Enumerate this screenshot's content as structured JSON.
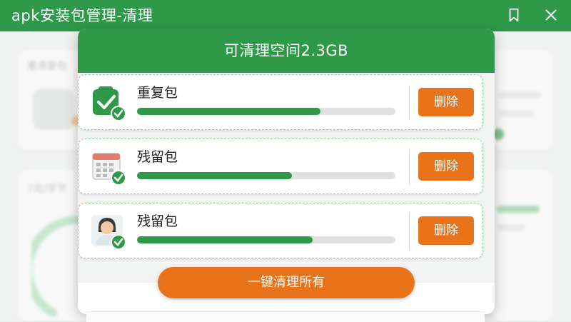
{
  "app": {
    "title": "apk安装包管理-清理",
    "icons": [
      "bookmark-icon",
      "close-icon"
    ]
  },
  "dialog": {
    "title": "可清理空间2.3GB",
    "items": [
      {
        "label": "重复包",
        "progress": 0.71,
        "icon": "duplicate-package-icon",
        "delete_label": "删除"
      },
      {
        "label": "残留包",
        "progress": 0.6,
        "icon": "calendar-residual-icon",
        "delete_label": "删除"
      },
      {
        "label": "残留包",
        "progress": 0.68,
        "icon": "person-residual-icon",
        "delete_label": "删除"
      }
    ],
    "clean_all_label": "一键清理所有"
  },
  "background": {
    "card1_title": "重清复包",
    "card2_title": "7兆/字节"
  },
  "colors": {
    "primary_green": "#2e9a49",
    "accent_orange": "#e8731a"
  }
}
